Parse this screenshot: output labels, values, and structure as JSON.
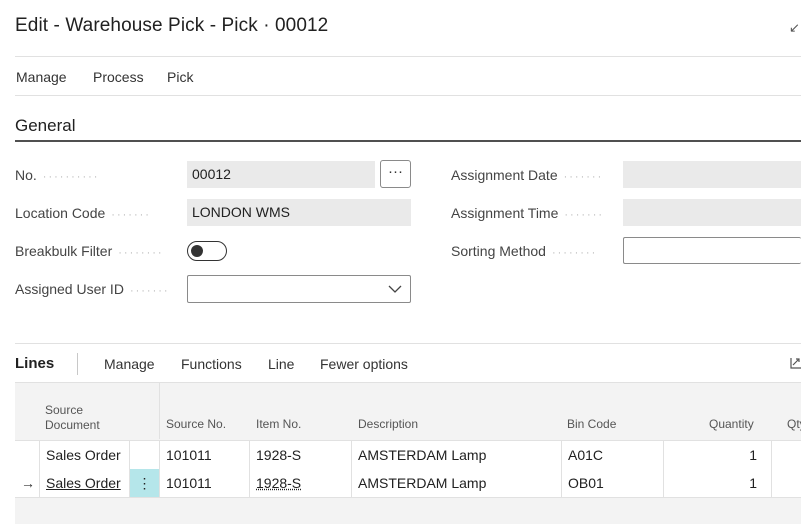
{
  "page": {
    "title": "Edit - Warehouse Pick - Pick · 00012",
    "collapse_icon": "collapse-arrow-icon"
  },
  "actions": [
    "Manage",
    "Process",
    "Pick"
  ],
  "general": {
    "section_title": "General",
    "no": {
      "label": "No.",
      "value": "00012"
    },
    "location_code": {
      "label": "Location Code",
      "value": "LONDON WMS"
    },
    "breakbulk_filter": {
      "label": "Breakbulk Filter",
      "value": false
    },
    "assigned_user_id": {
      "label": "Assigned User ID",
      "value": ""
    },
    "assignment_date": {
      "label": "Assignment Date",
      "value": ""
    },
    "assignment_time": {
      "label": "Assignment Time",
      "value": ""
    },
    "sorting_method": {
      "label": "Sorting Method",
      "value": ""
    },
    "assist_glyph": "···"
  },
  "lines": {
    "title": "Lines",
    "actions": [
      "Manage",
      "Functions",
      "Line",
      "Fewer options"
    ],
    "headers": {
      "source_document_1": "Source",
      "source_document_2": "Document",
      "source_no": "Source No.",
      "item_no": "Item No.",
      "description": "Description",
      "bin_code": "Bin Code",
      "quantity": "Quantity",
      "qty_partial": "Qty"
    },
    "rows": [
      {
        "source_document": "Sales Order",
        "source_no": "101011",
        "item_no": "1928-S",
        "description": "AMSTERDAM Lamp",
        "bin_code": "A01C",
        "quantity": "1"
      },
      {
        "source_document": "Sales Order",
        "source_no": "101011",
        "item_no": "1928-S",
        "description": "AMSTERDAM Lamp",
        "bin_code": "OB01",
        "quantity": "1"
      }
    ],
    "row_indicator": "→",
    "row_menu_glyph": "⋮"
  }
}
